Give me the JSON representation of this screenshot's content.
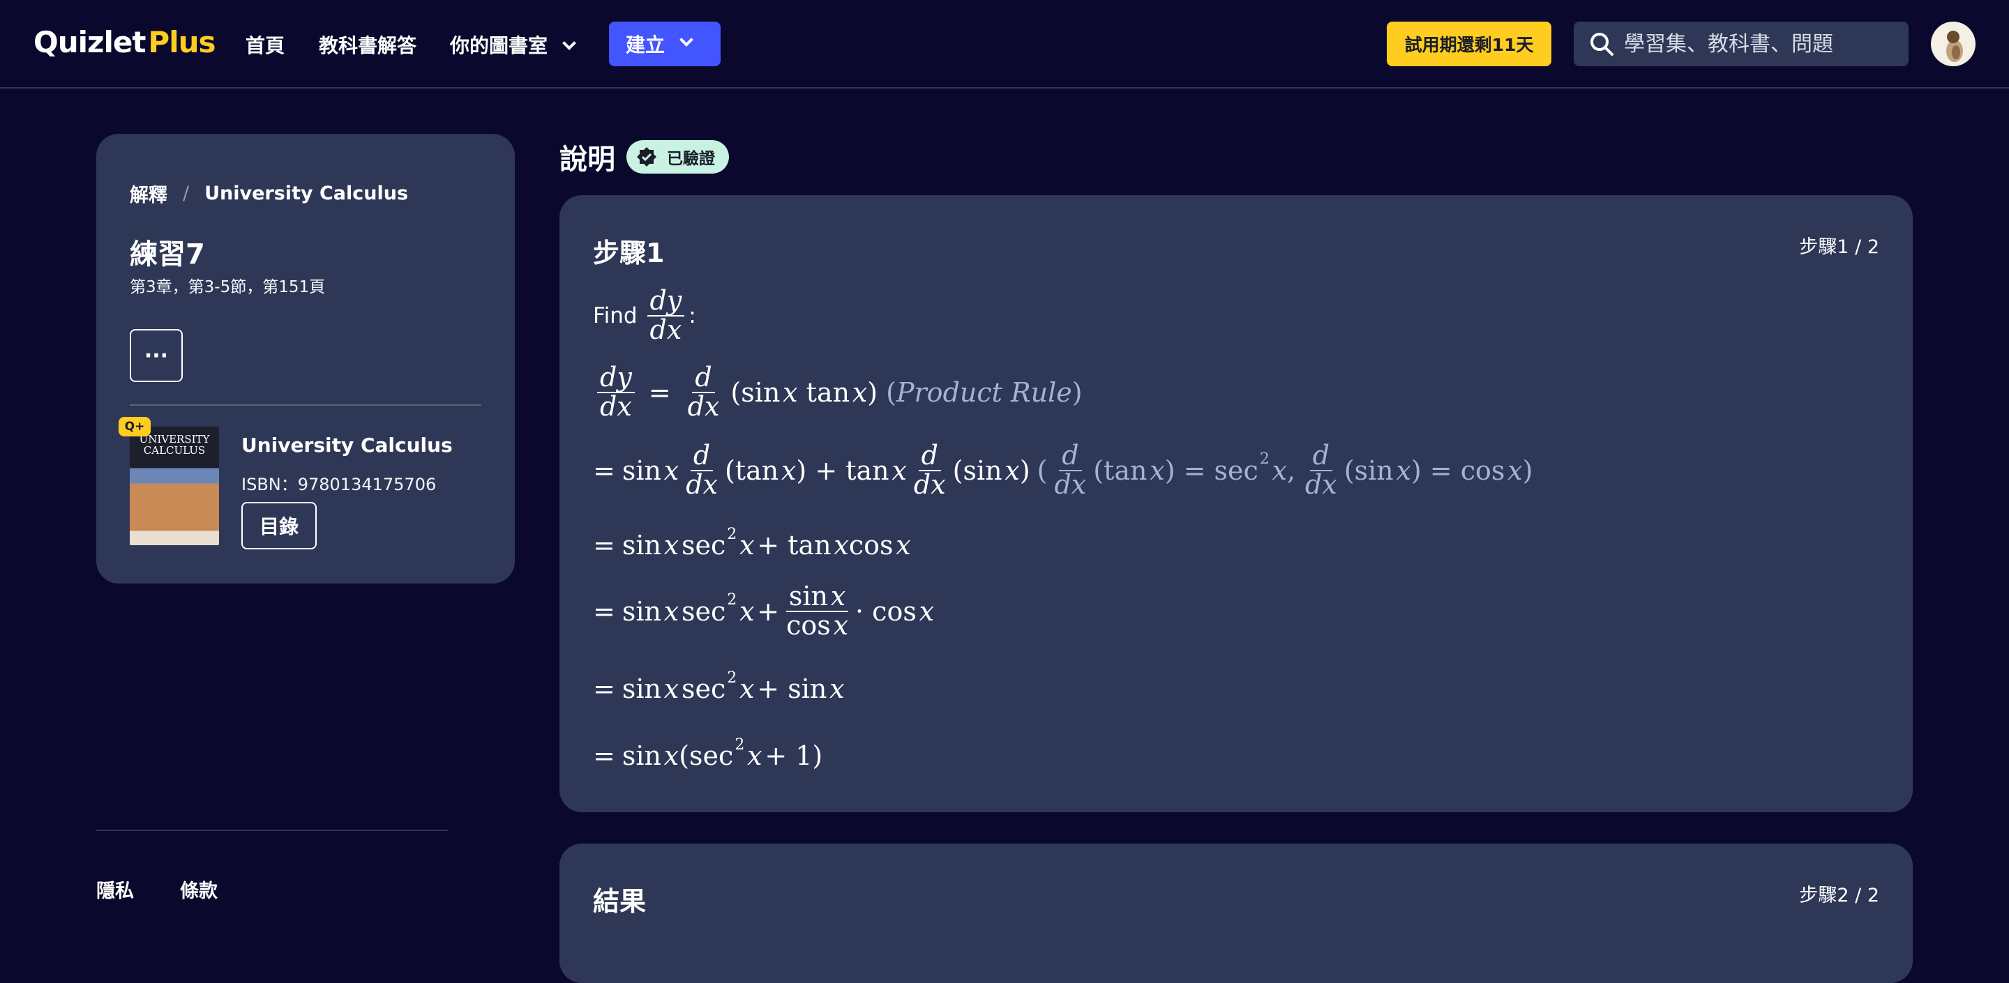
{
  "header": {
    "logo_main": "Quizlet",
    "logo_plus": "Plus",
    "nav_home": "首頁",
    "nav_solutions": "教科書解答",
    "nav_library": "你的圖書室",
    "create_label": "建立",
    "trial_label": "試用期還剩11天",
    "search_placeholder": "學習集、教科書、問題"
  },
  "sidebar": {
    "breadcrumb_root": "解釋",
    "breadcrumb_separator": "/",
    "breadcrumb_book": "University Calculus",
    "exercise_title": "練習7",
    "exercise_location": "第3章，第3-5節，第151頁",
    "more_label": "···",
    "plus_badge": "Q+",
    "book_cover_title": "UNIVERSITY CALCULUS",
    "book_title": "University Calculus",
    "isbn": "ISBN：9780134175706",
    "toc_label": "目錄"
  },
  "footer": {
    "privacy": "隱私",
    "terms": "條款"
  },
  "explanation": {
    "heading": "說明",
    "verified_label": "已驗證",
    "step1": {
      "title": "步驟1",
      "counter": "步驟1 / 2",
      "find_label": "Find",
      "product_rule_note": "Product Rule"
    },
    "result": {
      "title": "結果",
      "counter": "步驟2 / 2"
    }
  },
  "colors": {
    "background": "#0a092d",
    "card": "#2e3856",
    "accent_blue": "#4255ff",
    "accent_yellow": "#ffcd1f",
    "verified_bg": "#c8f3e3"
  },
  "icons": [
    "search-icon",
    "chevron-down-icon",
    "verified-check-icon",
    "avatar"
  ]
}
